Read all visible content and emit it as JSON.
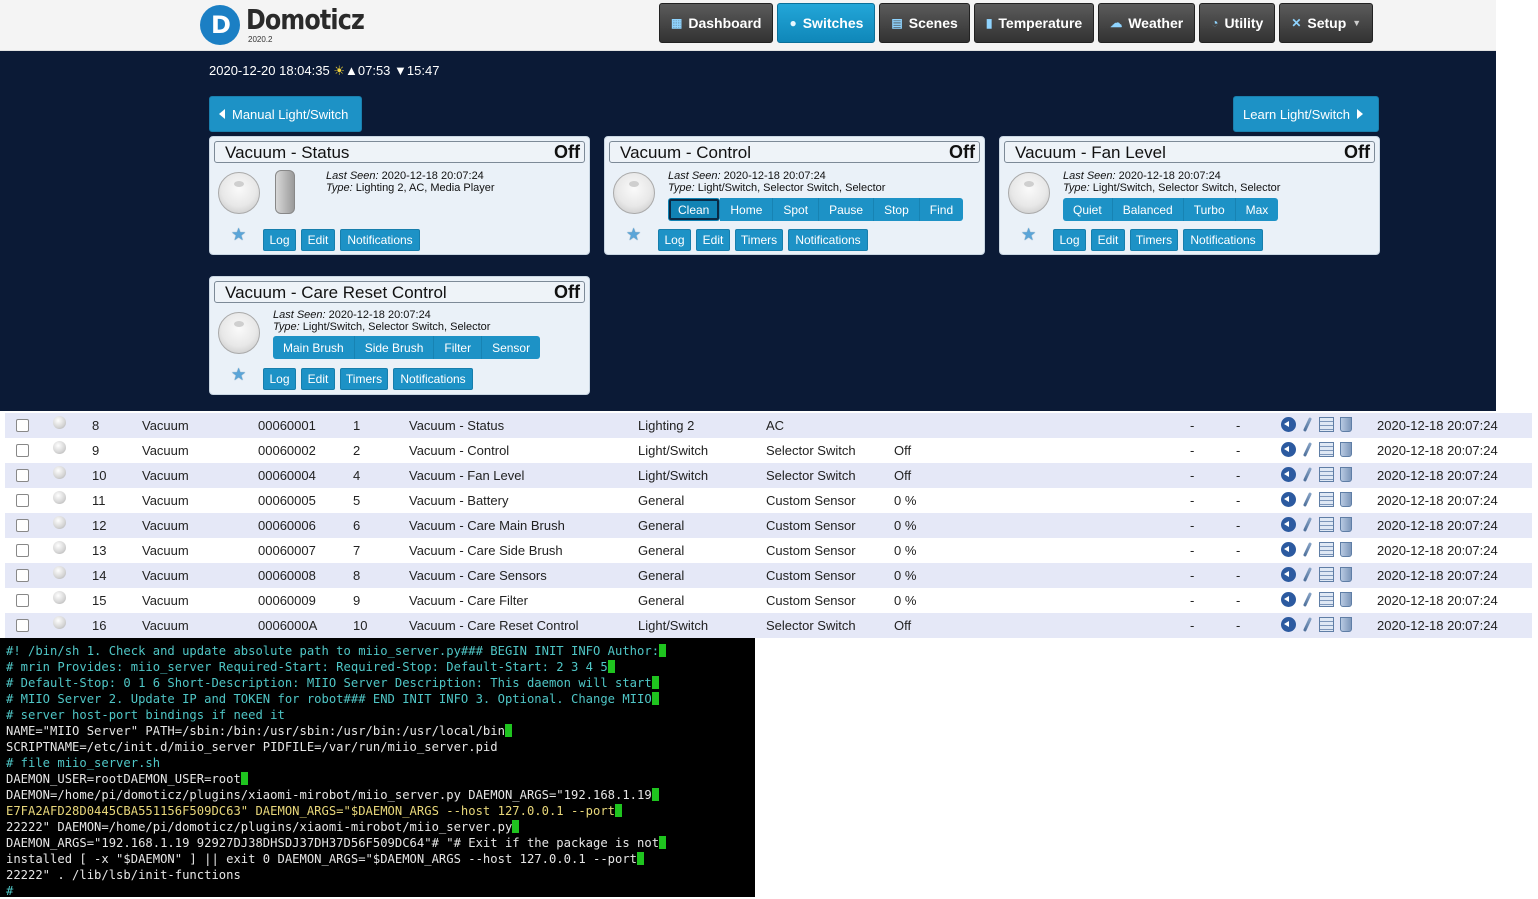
{
  "app": {
    "name": "Domoticz",
    "version": "2020.2"
  },
  "nav": [
    {
      "label": "Dashboard",
      "icon": "dashboard-icon",
      "active": false
    },
    {
      "label": "Switches",
      "icon": "lightbulb-icon",
      "active": true
    },
    {
      "label": "Scenes",
      "icon": "clapperboard-icon",
      "active": false
    },
    {
      "label": "Temperature",
      "icon": "thermometer-icon",
      "active": false
    },
    {
      "label": "Weather",
      "icon": "weather-cloud-icon",
      "active": false
    },
    {
      "label": "Utility",
      "icon": "utility-gauge-icon",
      "active": false
    },
    {
      "label": "Setup",
      "icon": "tools-icon",
      "active": false
    }
  ],
  "clock": {
    "datetime": "2020-12-20 18:04:35",
    "sunrise": "07:53",
    "sunset": "15:47"
  },
  "actions": {
    "manual": "Manual Light/Switch",
    "learn": "Learn Light/Switch"
  },
  "labels": {
    "last_seen": "Last Seen:",
    "type": "Type:"
  },
  "cards": [
    {
      "title": "Vacuum - Status",
      "state": "Off",
      "last_seen": "2020-12-18 20:07:24",
      "type": "Lighting 2, AC, Media Player",
      "buttons": [
        "Log",
        "Edit",
        "Notifications"
      ]
    },
    {
      "title": "Vacuum - Control",
      "state": "Off",
      "last_seen": "2020-12-18 20:07:24",
      "type": "Light/Switch, Selector Switch, Selector",
      "options": [
        "Clean",
        "Home",
        "Spot",
        "Pause",
        "Stop",
        "Find"
      ],
      "selected": "Clean",
      "buttons": [
        "Log",
        "Edit",
        "Timers",
        "Notifications"
      ]
    },
    {
      "title": "Vacuum - Fan Level",
      "state": "Off",
      "last_seen": "2020-12-18 20:07:24",
      "type": "Light/Switch, Selector Switch, Selector",
      "options": [
        "Quiet",
        "Balanced",
        "Turbo",
        "Max"
      ],
      "buttons": [
        "Log",
        "Edit",
        "Timers",
        "Notifications"
      ]
    },
    {
      "title": "Vacuum - Care Reset Control",
      "state": "Off",
      "last_seen": "2020-12-18 20:07:24",
      "type": "Light/Switch, Selector Switch, Selector",
      "options": [
        "Main Brush",
        "Side Brush",
        "Filter",
        "Sensor"
      ],
      "buttons": [
        "Log",
        "Edit",
        "Timers",
        "Notifications"
      ]
    }
  ],
  "table": {
    "rows": [
      {
        "idx": "8",
        "hw": "Vacuum",
        "id": "00060001",
        "unit": "1",
        "name": "Vacuum - Status",
        "type": "Lighting 2",
        "subtype": "AC",
        "data": "",
        "c1": "-",
        "c2": "-",
        "lastseen": "2020-12-18 20:07:24"
      },
      {
        "idx": "9",
        "hw": "Vacuum",
        "id": "00060002",
        "unit": "2",
        "name": "Vacuum - Control",
        "type": "Light/Switch",
        "subtype": "Selector Switch",
        "data": "Off",
        "c1": "-",
        "c2": "-",
        "lastseen": "2020-12-18 20:07:24"
      },
      {
        "idx": "10",
        "hw": "Vacuum",
        "id": "00060004",
        "unit": "4",
        "name": "Vacuum - Fan Level",
        "type": "Light/Switch",
        "subtype": "Selector Switch",
        "data": "Off",
        "c1": "-",
        "c2": "-",
        "lastseen": "2020-12-18 20:07:24"
      },
      {
        "idx": "11",
        "hw": "Vacuum",
        "id": "00060005",
        "unit": "5",
        "name": "Vacuum - Battery",
        "type": "General",
        "subtype": "Custom Sensor",
        "data": "0 %",
        "c1": "-",
        "c2": "-",
        "lastseen": "2020-12-18 20:07:24"
      },
      {
        "idx": "12",
        "hw": "Vacuum",
        "id": "00060006",
        "unit": "6",
        "name": "Vacuum - Care Main Brush",
        "type": "General",
        "subtype": "Custom Sensor",
        "data": "0 %",
        "c1": "-",
        "c2": "-",
        "lastseen": "2020-12-18 20:07:24"
      },
      {
        "idx": "13",
        "hw": "Vacuum",
        "id": "00060007",
        "unit": "7",
        "name": "Vacuum - Care Side Brush",
        "type": "General",
        "subtype": "Custom Sensor",
        "data": "0 %",
        "c1": "-",
        "c2": "-",
        "lastseen": "2020-12-18 20:07:24"
      },
      {
        "idx": "14",
        "hw": "Vacuum",
        "id": "00060008",
        "unit": "8",
        "name": "Vacuum - Care Sensors",
        "type": "General",
        "subtype": "Custom Sensor",
        "data": "0 %",
        "c1": "-",
        "c2": "-",
        "lastseen": "2020-12-18 20:07:24"
      },
      {
        "idx": "15",
        "hw": "Vacuum",
        "id": "00060009",
        "unit": "9",
        "name": "Vacuum - Care Filter",
        "type": "General",
        "subtype": "Custom Sensor",
        "data": "0 %",
        "c1": "-",
        "c2": "-",
        "lastseen": "2020-12-18 20:07:24"
      },
      {
        "idx": "16",
        "hw": "Vacuum",
        "id": "0006000A",
        "unit": "10",
        "name": "Vacuum - Care Reset Control",
        "type": "Light/Switch",
        "subtype": "Selector Switch",
        "data": "Off",
        "c1": "-",
        "c2": "-",
        "lastseen": "2020-12-18 20:07:24"
      }
    ]
  },
  "terminal": {
    "lines": [
      "#! /bin/sh 1. Check and update absolute path to miio_server.py### BEGIN INIT INFO Author:",
      "# mrin Provides: miio_server Required-Start: Required-Stop: Default-Start: 2 3 4 5",
      "# Default-Stop: 0 1 6 Short-Description: MIIO Server Description: This daemon will start",
      "# MIIO Server 2. Update IP and TOKEN for robot### END INIT INFO 3. Optional. Change MIIO",
      "# server host-port bindings if need it",
      "NAME=\"MIIO Server\" PATH=/sbin:/bin:/usr/sbin:/usr/bin:/usr/local/bin",
      "SCRIPTNAME=/etc/init.d/miio_server PIDFILE=/var/run/miio_server.pid",
      "# file miio_server.sh",
      "DAEMON_USER=rootDAEMON_USER=root",
      "DAEMON=/home/pi/domoticz/plugins/xiaomi-mirobot/miio_server.py DAEMON_ARGS=\"192.168.1.19",
      "E7FA2AFD28D0445CBA551156F509DC63\" DAEMON_ARGS=\"$DAEMON_ARGS --host 127.0.0.1 --port",
      "22222\" DAEMON=/home/pi/domoticz/plugins/xiaomi-mirobot/miio_server.py",
      "DAEMON_ARGS=\"192.168.1.19 92927DJ38DHSDJ37DH37D56F509DC64\"# \"# Exit if the package is not",
      "installed [ -x \"$DAEMON\" ] || exit 0 DAEMON_ARGS=\"$DAEMON_ARGS --host 127.0.0.1 --port",
      "22222\" . /lib/lsb/init-functions",
      "#"
    ]
  }
}
